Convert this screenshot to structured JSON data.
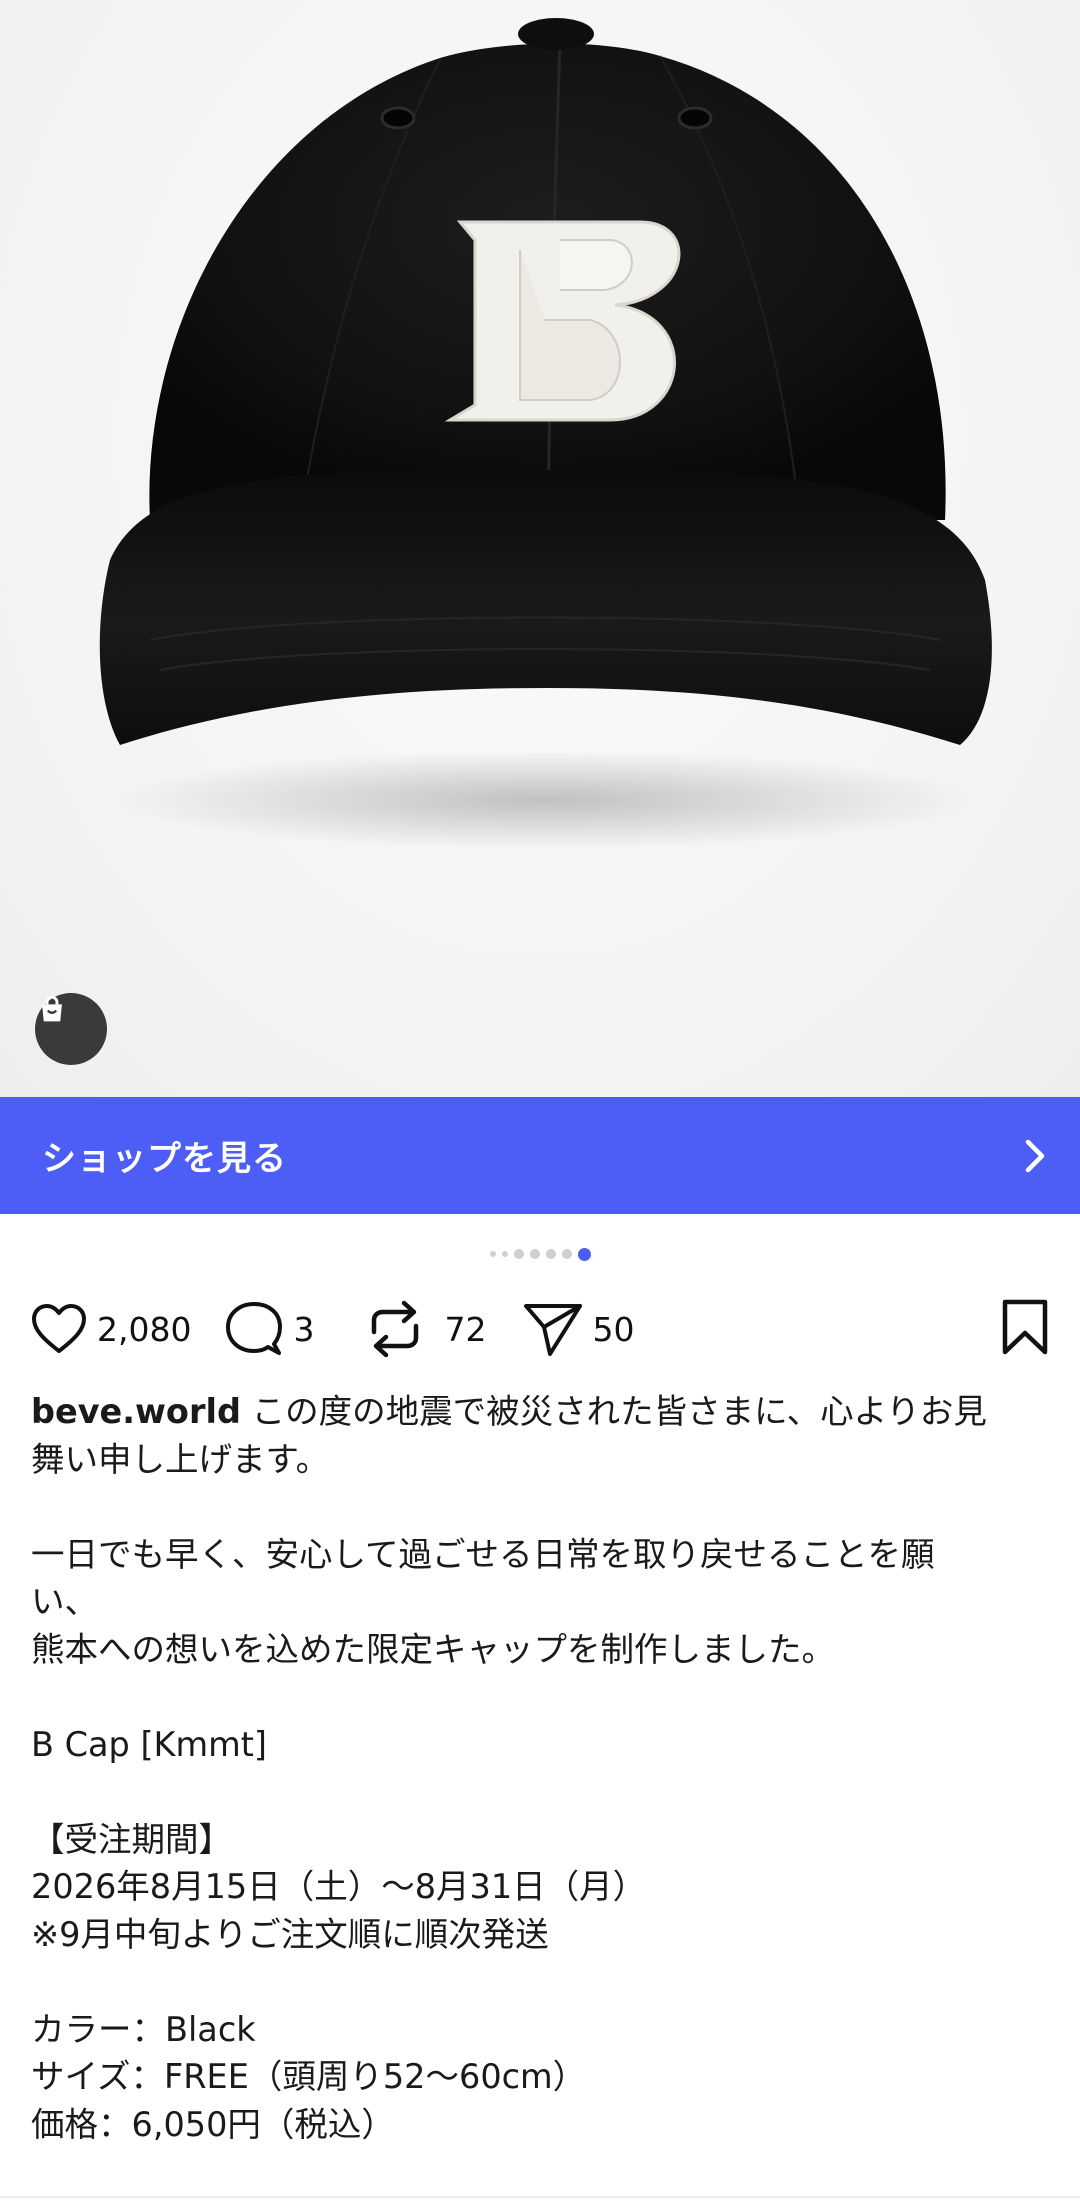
{
  "shop_bar": {
    "label": "ショップを見る"
  },
  "carousel": {
    "count": 7,
    "active_index": 6
  },
  "actions": {
    "likes": "2,080",
    "comments": "3",
    "reposts": "72",
    "shares": "50"
  },
  "post": {
    "username": "beve.world",
    "caption": " この度の地震で被災された皆さまに、心よりお見\n舞い申し上げます。\n\n一日でも早く、安心して過ごせる日常を取り戻せることを願\nい、\n熊本への想いを込めた限定キャップを制作しました。\n\nB Cap [Kmmt]\n\n【受注期間】\n2026年8月15日（土）～8月31日（月）\n※9月中旬よりご注文順に順次発送\n\nカラー：Black\nサイズ：FREE（頭周り52～60cm）\n価格：6,050円（税込）"
  },
  "icons": {
    "shop_tag": "shopping-bag-icon",
    "chevron": "chevron-right-icon",
    "like": "heart-icon",
    "comment": "comment-bubble-icon",
    "repost": "repost-icon",
    "share": "send-icon",
    "bookmark": "bookmark-icon"
  },
  "colors": {
    "accent": "#4d5ef7",
    "cap": "#111111",
    "logo": "#f2f0ea"
  }
}
